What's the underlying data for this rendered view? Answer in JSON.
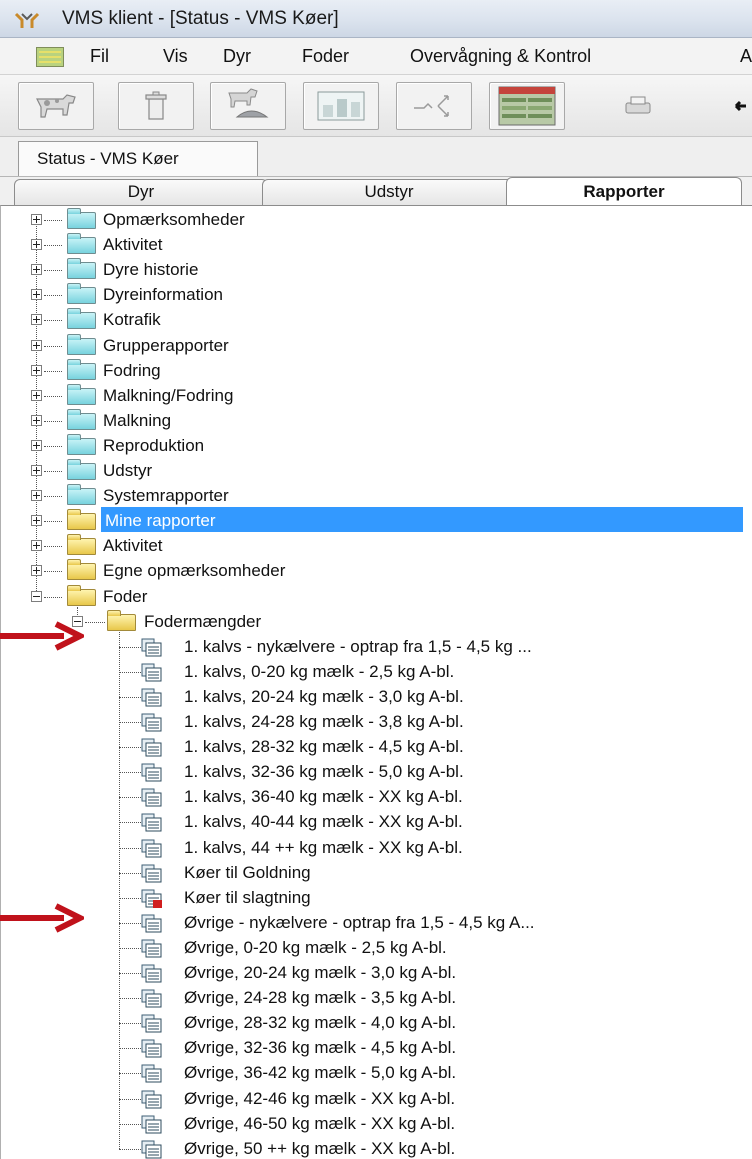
{
  "window": {
    "title": "VMS klient - [Status - VMS Køer]"
  },
  "menubar": {
    "items": [
      "Fil",
      "Vis",
      "Dyr",
      "Foder",
      "Overvågning & Kontrol",
      "A"
    ]
  },
  "toolbar": {
    "buttons": [
      "cow-icon",
      "trash-icon",
      "cow-feed-icon",
      "chart-icon",
      "route-icon",
      "report-grid-icon",
      "printer-icon",
      "back-arrow-icon"
    ]
  },
  "document_tab": {
    "label": "Status - VMS Køer"
  },
  "panel_tabs": [
    "Dyr",
    "Udstyr",
    "Rapporter"
  ],
  "tree": {
    "root_folders": [
      {
        "label": "Opmærksomheder",
        "color": "teal"
      },
      {
        "label": "Aktivitet",
        "color": "teal"
      },
      {
        "label": "Dyre historie",
        "color": "teal"
      },
      {
        "label": "Dyreinformation",
        "color": "teal"
      },
      {
        "label": "Kotrafik",
        "color": "teal"
      },
      {
        "label": "Grupperapporter",
        "color": "teal"
      },
      {
        "label": "Fodring",
        "color": "teal"
      },
      {
        "label": "Malkning/Fodring",
        "color": "teal"
      },
      {
        "label": "Malkning",
        "color": "teal"
      },
      {
        "label": "Reproduktion",
        "color": "teal"
      },
      {
        "label": "Udstyr",
        "color": "teal"
      },
      {
        "label": "Systemrapporter",
        "color": "teal"
      },
      {
        "label": "Mine rapporter",
        "color": "yellow",
        "selected": true
      },
      {
        "label": "Aktivitet",
        "color": "yellow"
      },
      {
        "label": "Egne opmærksomheder",
        "color": "yellow"
      },
      {
        "label": "Foder",
        "color": "yellow",
        "expanded": true
      }
    ],
    "subfolder": {
      "label": "Fodermængder"
    },
    "reports": [
      "1. kalvs - nykælvere - optrap fra 1,5 - 4,5 kg ...",
      "1. kalvs, 0-20 kg mælk - 2,5 kg A-bl.",
      "1. kalvs, 20-24 kg mælk - 3,0 kg A-bl.",
      "1. kalvs, 24-28 kg mælk - 3,8 kg A-bl.",
      "1. kalvs, 28-32 kg mælk - 4,5 kg A-bl.",
      "1. kalvs, 32-36 kg mælk  - 5,0 kg A-bl.",
      "1. kalvs, 36-40 kg mælk  - XX kg A-bl.",
      "1. kalvs, 40-44 kg mælk  - XX kg A-bl.",
      "1. kalvs, 44 ++ kg mælk  - XX kg A-bl.",
      "Køer til Goldning",
      "Køer til slagtning",
      "Øvrige - nykælvere - optrap fra 1,5 - 4,5 kg A...",
      "Øvrige, 0-20 kg mælk  - 2,5 kg A-bl.",
      "Øvrige, 20-24 kg mælk  - 3,0 kg A-bl.",
      "Øvrige, 24-28 kg mælk  - 3,5 kg A-bl.",
      "Øvrige, 28-32 kg mælk  - 4,0 kg A-bl.",
      "Øvrige, 32-36 kg mælk  - 4,5 kg A-bl.",
      "Øvrige, 36-42 kg mælk  - 5,0 kg A-bl.",
      "Øvrige, 42-46 kg mælk  - XX kg A-bl.",
      "Øvrige, 46-50 kg mælk  - XX kg A-bl.",
      "Øvrige, 50 ++ kg mælk  - XX kg A-bl."
    ]
  },
  "annotation_color": "#c0121b"
}
